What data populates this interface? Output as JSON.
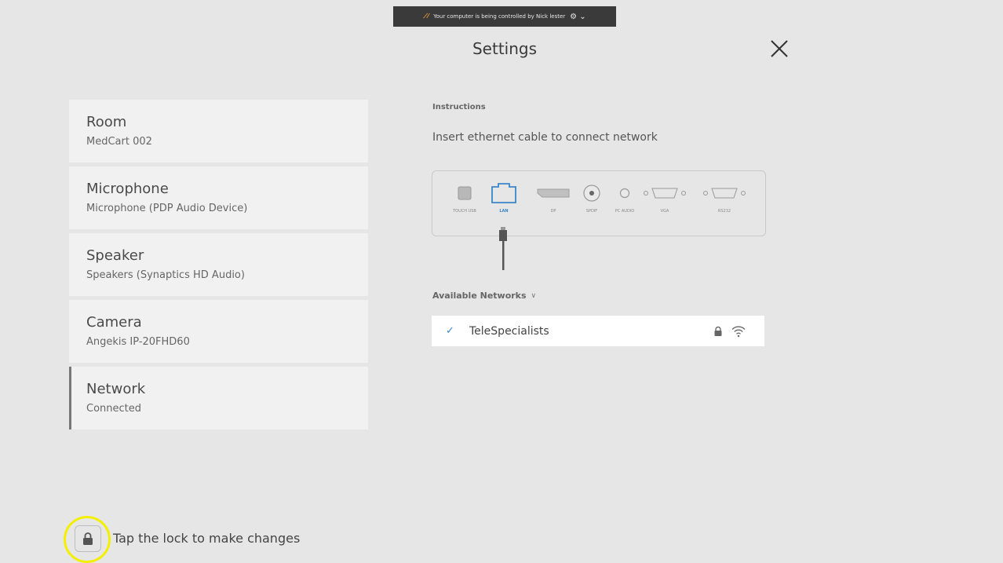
{
  "banner": {
    "text": "Your computer is being controlled by Nick lester"
  },
  "header": {
    "title": "Settings"
  },
  "menu": {
    "items": [
      {
        "label": "Room",
        "value": "MedCart 002"
      },
      {
        "label": "Microphone",
        "value": "Microphone (PDP Audio Device)"
      },
      {
        "label": "Speaker",
        "value": "Speakers (Synaptics HD Audio)"
      },
      {
        "label": "Camera",
        "value": "Angekis IP-20FHD60"
      },
      {
        "label": "Network",
        "value": "Connected"
      }
    ],
    "active": "Network"
  },
  "main": {
    "instructions_heading": "Instructions",
    "instructions_text": "Insert ethernet cable to connect network",
    "ports": [
      {
        "label": "TOUCH USB",
        "icon": "usb-port-icon"
      },
      {
        "label": "LAN",
        "icon": "lan-port-icon"
      },
      {
        "label": "DP",
        "icon": "displayport-icon"
      },
      {
        "label": "SPDIF",
        "icon": "spdif-port-icon"
      },
      {
        "label": "PC AUDIO",
        "icon": "audio-jack-icon"
      },
      {
        "label": "VGA",
        "icon": "vga-port-icon"
      },
      {
        "label": "RS232",
        "icon": "rs232-port-icon"
      }
    ],
    "networks_heading": "Available Networks",
    "networks": [
      {
        "name": "TeleSpecialists",
        "connected": true,
        "secured": true
      }
    ]
  },
  "footer": {
    "lock_text": "Tap the lock to make changes"
  },
  "colors": {
    "background": "#e6e6e6",
    "accent": "#3a86c8",
    "highlight": "#f2f000"
  }
}
